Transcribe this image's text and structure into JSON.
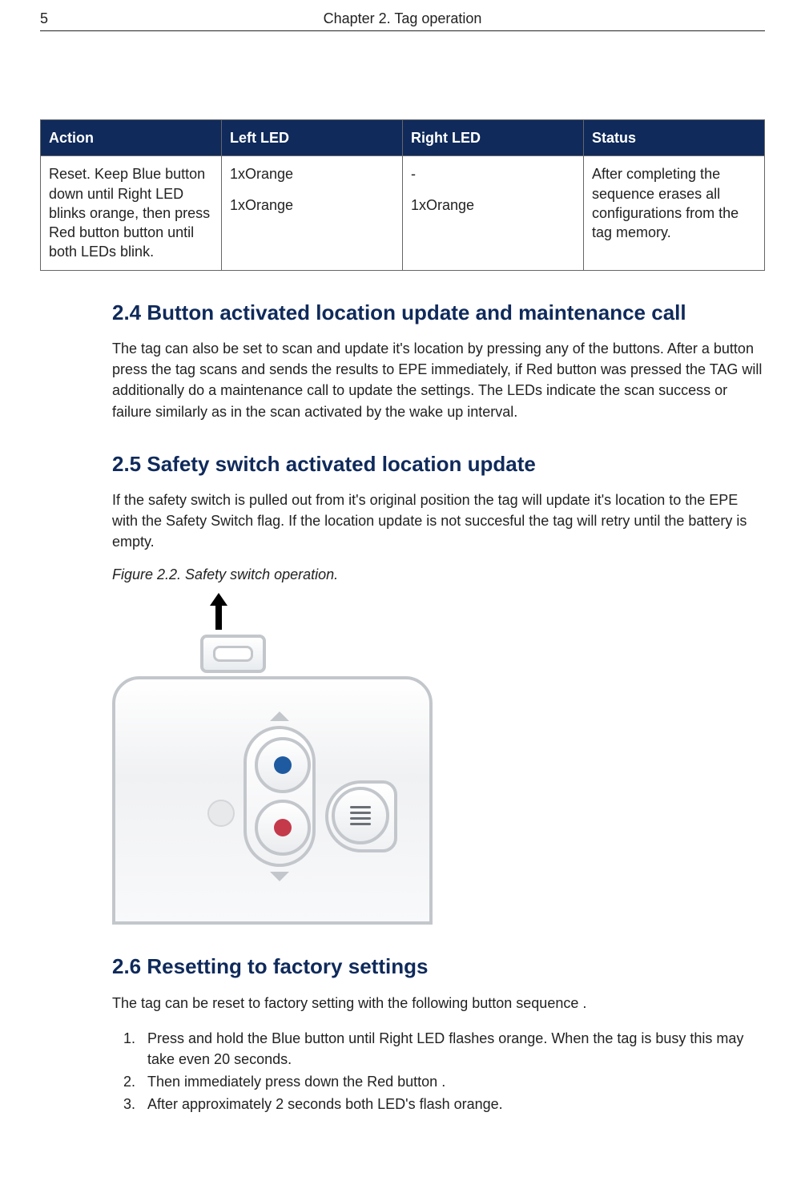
{
  "header": {
    "page_number": "5",
    "chapter_title": "Chapter 2. Tag operation"
  },
  "table": {
    "headers": [
      "Action",
      "Left LED",
      "Right LED",
      "Status"
    ],
    "row": {
      "action": "Reset. Keep Blue button down until Right LED blinks orange, then press Red button button until both LEDs blink.",
      "left_led_line1": "1xOrange",
      "left_led_line2": "1xOrange",
      "right_led_line1": "-",
      "right_led_line2": "1xOrange",
      "status": "After completing the sequence erases all configurations from the tag memory."
    }
  },
  "sections": {
    "s24": {
      "title": "2.4  Button activated location update and maintenance call",
      "body": "The tag can also be set to scan and update it's location by pressing any of the buttons. After a button press the tag scans and sends the results to EPE immediately, if Red button was pressed the TAG will additionally do a maintenance call to update the settings. The LEDs indicate the scan success or failure similarly as in the scan activated by the wake up interval."
    },
    "s25": {
      "title": "2.5  Safety switch activated location update",
      "body": "If the safety switch is pulled out from it's original position the tag will update it's location to the EPE with the Safety Switch flag. If the location update is not succesful the tag will retry until the battery is empty.",
      "caption": "Figure 2.2. Safety switch operation."
    },
    "s26": {
      "title": "2.6  Resetting to factory settings",
      "intro": "The tag can be reset to factory setting with the following button sequence .",
      "steps": [
        "Press and hold the Blue button until Right LED flashes orange. When the tag is busy this may take even 20 seconds.",
        "Then immediately press down the Red button .",
        "After approximately 2 seconds both LED's flash orange."
      ]
    }
  },
  "icons": {
    "arrow_up": "arrow-up-icon",
    "blue_button": "blue-button-icon",
    "red_button": "red-button-icon",
    "menu_button": "menu-lines-icon",
    "safety_switch": "safety-switch-icon"
  }
}
